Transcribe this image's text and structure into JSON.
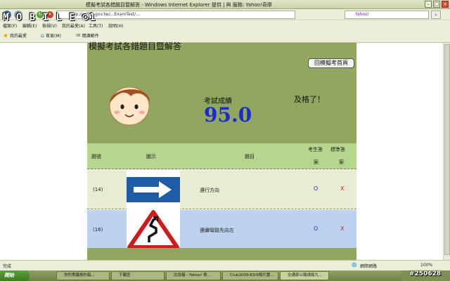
{
  "window": {
    "title": "模擬考試各錯題目暨解答 - Windows Internet Explorer 提供 | 與 服務: Yahoo!奇摩"
  },
  "address_bar": {
    "url": "http://...thb.gov.tw/...ExamTest/...",
    "search_placeholder": "Yahoo!"
  },
  "menu": [
    "檔案(F)",
    "編輯(E)",
    "檢視(V)",
    "我的最愛(A)",
    "工具(T)",
    "說明(H)"
  ],
  "favorites_bar": {
    "favorites_label": "我的最愛",
    "home_label": "首頁(M)",
    "reader_label": "閱讀郵件"
  },
  "watermark": {
    "logo_text": "MOBILE01",
    "post_id": "#250628"
  },
  "page": {
    "title": "模擬考試各錯題目暨解答",
    "back_button": "回模擬考首頁",
    "score_label": "考試成績",
    "score": "95.0",
    "result": "及格了！",
    "table": {
      "headers": {
        "number": "題號",
        "illustration": "圖示",
        "question": "題目",
        "your_answer_1": "考生答",
        "your_answer_2": "案",
        "correct_answer_1": "標準答",
        "correct_answer_2": "案"
      },
      "rows": [
        {
          "number": "(14)",
          "sign": "arrow-right-sign-icon",
          "question": "遵行方向",
          "your_answer": "O",
          "correct_answer": "X"
        },
        {
          "number": "(16)",
          "sign": "winding-road-sign-icon",
          "question": "連續彎路先向左",
          "your_answer": "O",
          "correct_answer": "X"
        }
      ]
    }
  },
  "status_bar": {
    "left": "完成",
    "zone": "網際網路",
    "zoom": "100%"
  },
  "taskbar": {
    "start_label": "開始",
    "tasks": [
      "你的実踐員的每...",
      "下載區",
      "垃圾箱 - Yahoo! 奇...",
      "Club1009-B3/9相片寶...",
      "交通部公路總局九..."
    ]
  },
  "colors": {
    "header_green": "#91a75f",
    "table_head_green": "#b8d58e",
    "score_blue": "#1a2bd1",
    "wrong_red": "#d11a1a",
    "row_blue": "#bcd2ef"
  }
}
